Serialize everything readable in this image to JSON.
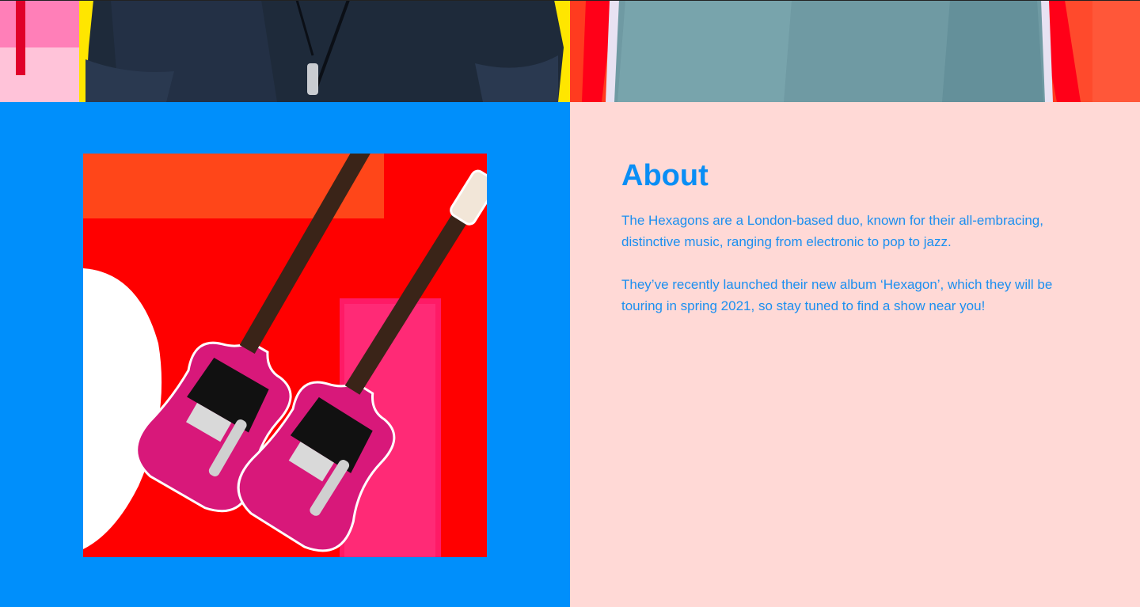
{
  "hero": {
    "image": "band-members-photo"
  },
  "about": {
    "title": "About",
    "paragraphs": [
      "The Hexagons are a London-based duo, known for their all-embracing, distinctive music, ranging from electronic to pop to jazz.",
      "They’ve recently launched their new album ‘Hexagon’, which they will be touring in spring 2021, so stay tuned to find a show near you!"
    ],
    "image": "pink-guitars-collage"
  },
  "colors": {
    "left_panel_bg": "#008ffb",
    "right_panel_bg": "#ffd9d6",
    "accent_text": "#0a8ef5"
  }
}
